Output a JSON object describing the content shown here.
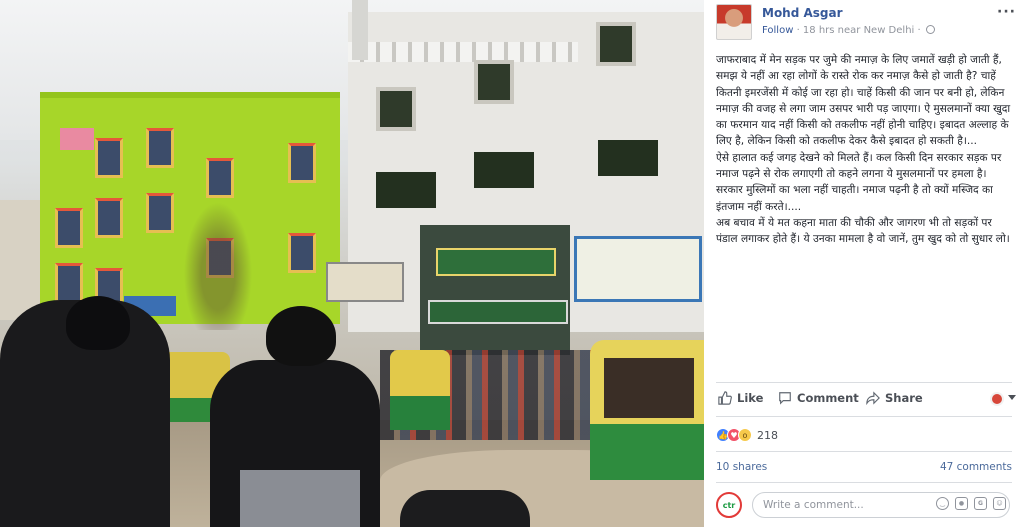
{
  "post": {
    "author": "Mohd Asgar",
    "follow_label": "Follow",
    "meta": "· 18 hrs near New Delhi ·",
    "more_label": "···",
    "paragraphs": [
      "जाफराबाद में मेन सड़क पर जुमे की नमाज़ के लिए जमातें खड़ी हो जाती हैं, समझ ये नहीं आ रहा लोगों के रास्ते रोक कर नमाज़ कैसे हो जाती है? चाहें कितनी इमरजेंसी में कोई जा रहा हो। चाहें किसी की जान पर बनी हो, लेकिन नमाज़ की वजह से लगा जाम उसपर भारी पड़ जाएगा। ऐ मुसलमानों क्या खुदा का फरमान याद नहीं किसी को तकलीफ नहीं होनी चाहिए। इबादत अल्लाह के लिए है, लेकिन किसी को तकलीफ देकर कैसे इबादत हो सकती है।...",
      "ऐसे हालात कई जगह देखने को मिलते हैं। कल किसी दिन सरकार सड़क पर नमाज पढ़ने से रोक लगाएगी तो कहने लगना ये मुसलमानों पर हमला है। सरकार मुस्लिमों का भला नहीं चाहती। नमाज पढ़नी है तो क्यों मस्जिद का इंतजाम नहीं करते।....",
      "अब बचाव में ये मत कहना माता की चौकी और जागरण भी तो सड़कों पर पंडाल लगाकर होते हैं। ये उनका मामला है वो जानें, तुम खुद को तो सुधार लो।"
    ]
  },
  "actions": {
    "like_label": "Like",
    "comment_label": "Comment",
    "share_label": "Share"
  },
  "stats": {
    "reaction_count": "218",
    "shares": "10 shares",
    "comments": "47 comments"
  },
  "comment_box": {
    "placeholder": "Write a comment...",
    "avatar_text": "ctr"
  },
  "icons": {
    "like": "thumbs-up-icon",
    "comment": "speech-bubble-icon",
    "share": "share-arrow-icon",
    "emoji": "emoji-icon",
    "camera": "camera-icon",
    "gif": "gif-icon",
    "sticker": "sticker-icon"
  },
  "colors": {
    "link_blue": "#365899",
    "text": "#1d2129",
    "muted": "#90949c",
    "like_blue": "#4080ff",
    "love_red": "#f25268",
    "wow_yellow": "#f7c94b"
  }
}
